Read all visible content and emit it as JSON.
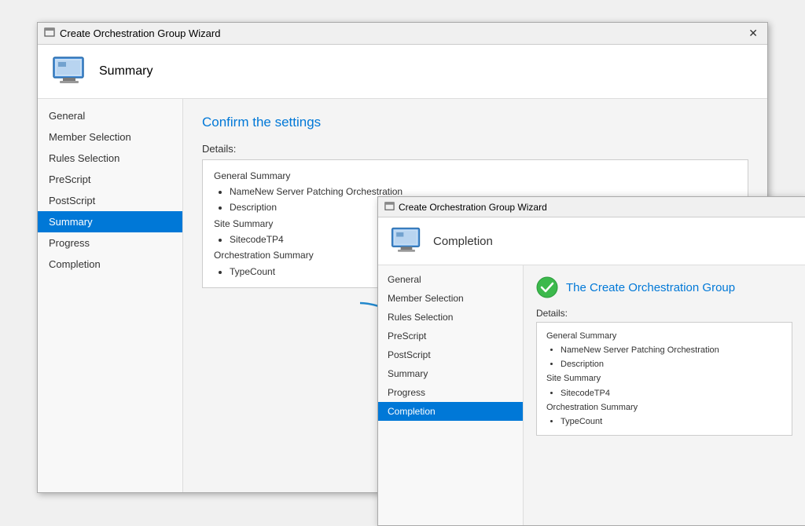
{
  "window": {
    "title": "Create Orchestration Group Wizard",
    "header_title": "Summary",
    "close_label": "✕"
  },
  "sidebar": {
    "items": [
      {
        "label": "General",
        "active": false
      },
      {
        "label": "Member Selection",
        "active": false
      },
      {
        "label": "Rules Selection",
        "active": false
      },
      {
        "label": "PreScript",
        "active": false
      },
      {
        "label": "PostScript",
        "active": false
      },
      {
        "label": "Summary",
        "active": true
      },
      {
        "label": "Progress",
        "active": false
      },
      {
        "label": "Completion",
        "active": false
      }
    ]
  },
  "main": {
    "title": "Confirm the settings",
    "details_label": "Details:",
    "details": {
      "general_summary_label": "General Summary",
      "general_items": [
        "NameNew Server Patching Orchestration",
        "Description"
      ],
      "site_summary_label": "Site Summary",
      "site_items": [
        "SitecodeTP4"
      ],
      "orchestration_summary_label": "Orchestration Summary",
      "orchestration_items": [
        "TypeCount"
      ]
    }
  },
  "popup": {
    "title": "Create Orchestration Group Wizard",
    "header_title": "Completion",
    "success_title": "The Create Orchestration Group",
    "details_label": "Details:",
    "sidebar_items": [
      {
        "label": "General",
        "active": false
      },
      {
        "label": "Member Selection",
        "active": false
      },
      {
        "label": "Rules Selection",
        "active": false
      },
      {
        "label": "PreScript",
        "active": false
      },
      {
        "label": "PostScript",
        "active": false
      },
      {
        "label": "Summary",
        "active": false
      },
      {
        "label": "Progress",
        "active": false
      },
      {
        "label": "Completion",
        "active": true
      }
    ],
    "details": {
      "general_summary_label": "General Summary",
      "general_items": [
        "NameNew Server Patching Orchestration",
        "Description"
      ],
      "site_summary_label": "Site Summary",
      "site_items": [
        "SitecodeTP4"
      ],
      "orchestration_summary_label": "Orchestration Summary",
      "orchestration_items": [
        "TypeCount"
      ]
    }
  }
}
